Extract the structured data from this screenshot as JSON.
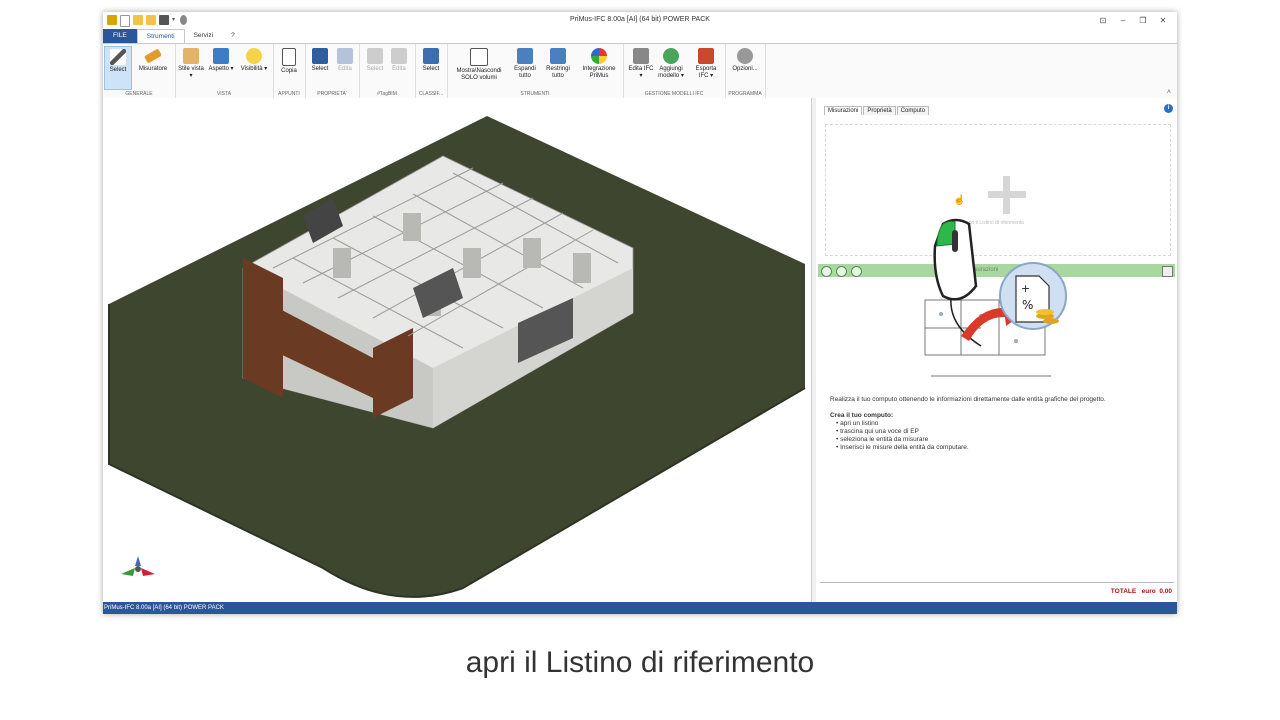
{
  "window": {
    "title": "PriMus-IFC  8.00a [AI]  (64 bit)  POWER PACK",
    "controls": [
      "⊡",
      "–",
      "❐",
      "✕"
    ]
  },
  "quick_access_icons": [
    "app-logo-icon",
    "new-file-icon",
    "open-folder-icon",
    "open-folder-icon",
    "save-icon",
    "dropdown-arrow-icon",
    "mic-icon"
  ],
  "ribbon_tabs": [
    {
      "label": "FILE"
    },
    {
      "label": "Strumenti"
    },
    {
      "label": "Servizi"
    },
    {
      "label": "?"
    }
  ],
  "ribbon": {
    "groups": [
      {
        "label": "GENERALE",
        "buttons": [
          {
            "label": "Select"
          },
          {
            "label": "Misuratore"
          }
        ]
      },
      {
        "label": "VISTA",
        "buttons": [
          {
            "label": "Stile vista ▾"
          },
          {
            "label": "Aspetto ▾"
          },
          {
            "label": "Visibilità ▾"
          }
        ]
      },
      {
        "label": "APPUNTI",
        "buttons": [
          {
            "label": "Copia"
          }
        ]
      },
      {
        "label": "PROPRIETA'",
        "buttons": [
          {
            "label": "Select"
          },
          {
            "label": "Edita"
          }
        ]
      },
      {
        "label": "#TagBIM",
        "buttons": [
          {
            "label": "Select"
          },
          {
            "label": "Edita"
          }
        ]
      },
      {
        "label": "CLASSIF...",
        "buttons": [
          {
            "label": "Select"
          }
        ]
      },
      {
        "label": "STRUMENTI",
        "buttons": [
          {
            "label": "Mostra\\Nascondi SOLO volumi"
          },
          {
            "label": "Espandi tutto"
          },
          {
            "label": "Restringi tutto"
          },
          {
            "label": "Integrazione PriMus"
          }
        ]
      },
      {
        "label": "GESTIONE MODELLI IFC",
        "buttons": [
          {
            "label": "Edita IFC ▾"
          },
          {
            "label": "Aggiungi modello ▾"
          },
          {
            "label": "Esporta IFC ▾"
          }
        ]
      },
      {
        "label": "PROGRAMMA",
        "buttons": [
          {
            "label": "Opzioni..."
          }
        ]
      }
    ]
  },
  "right_pane": {
    "tabs": [
      {
        "label": "Misurazioni"
      },
      {
        "label": "Proprietà"
      },
      {
        "label": "Computo"
      }
    ],
    "dropzone_text": "apri il Listino di riferimento",
    "measure_bar_label": "Misurazioni",
    "description": "Realizza il tuo computo ottenendo le informazioni direttamente dalle entità grafiche del progetto.",
    "steps_heading": "Crea il tuo computo:",
    "steps": [
      "apri un listino",
      "trascina qui una voce di EP",
      "seleziona le entità da misurare",
      "Inserisci le misure della entità da computare."
    ],
    "totale_label": "TOTALE",
    "totale_currency": "euro",
    "totale_value": "0.00"
  },
  "status_bar": "PriMus-IFC  8.00a [AI]  (64 bit)  POWER PACK",
  "caption": "apri il Listino di riferimento",
  "colors": {
    "file_tab": "#2b579a",
    "status_bar": "#2b579a",
    "ground": "#3f4630",
    "measure_bar": "#a8d8a0",
    "totale_text": "#aa1111"
  }
}
